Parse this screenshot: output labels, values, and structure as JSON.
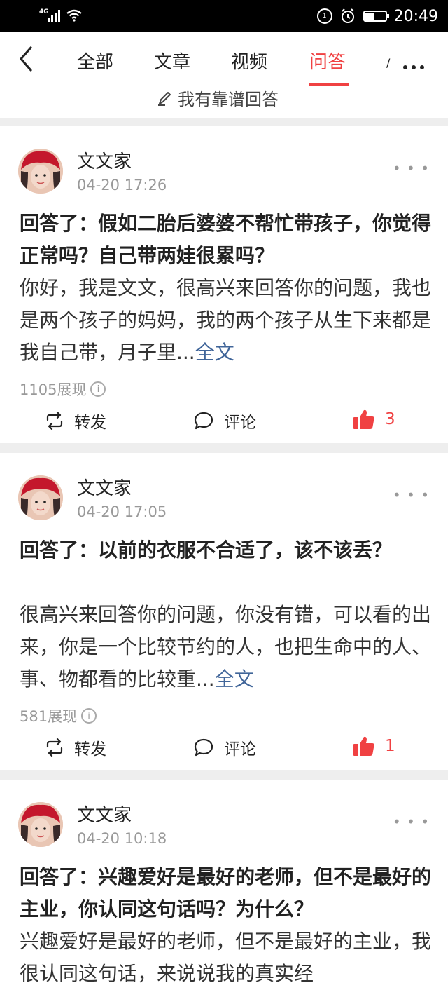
{
  "status_bar": {
    "network": "4G",
    "time": "20:49",
    "alarm_icon": "alarm-clock-icon",
    "battery_level": 0.4
  },
  "nav": {
    "tabs": [
      {
        "label": "全部",
        "active": false
      },
      {
        "label": "文章",
        "active": false
      },
      {
        "label": "视频",
        "active": false
      },
      {
        "label": "问答",
        "active": true
      }
    ],
    "partial_tab": "/",
    "accent": "#f04142"
  },
  "write_answer": {
    "label": "我有靠谱回答",
    "icon": "pen-icon"
  },
  "feed": [
    {
      "author": "文文家",
      "time": "04-20 17:26",
      "title_prefix": "回答了：",
      "title": "假如二胎后婆婆不帮忙带孩子，你觉得正常吗？自己带两娃很累吗？",
      "body": "你好，我是文文，很高兴来回答你的问题，我也是两个孩子的妈妈，我的两个孩子从生下来都是我自己带，月子里...",
      "more": "全文",
      "views": "1105展现",
      "repost": "转发",
      "comment": "评论",
      "likes": "3"
    },
    {
      "author": "文文家",
      "time": "04-20 17:05",
      "title_prefix": "回答了：",
      "title": "以前的衣服不合适了，该不该丢？",
      "body": "很高兴来回答你的问题，你没有错，可以看的出来，你是一个比较节约的人，也把生命中的人、事、物都看的比较重...",
      "more": "全文",
      "views": "581展现",
      "repost": "转发",
      "comment": "评论",
      "likes": "1"
    },
    {
      "author": "文文家",
      "time": "04-20 10:18",
      "title_prefix": "回答了：",
      "title": "兴趣爱好是最好的老师，但不是最好的主业，你认同这句话吗？为什么？",
      "body": "兴趣爱好是最好的老师，但不是最好的主业，我很认同这句话，来说说我的真实经",
      "more": "",
      "views": "",
      "repost": "",
      "comment": "",
      "likes": ""
    }
  ]
}
